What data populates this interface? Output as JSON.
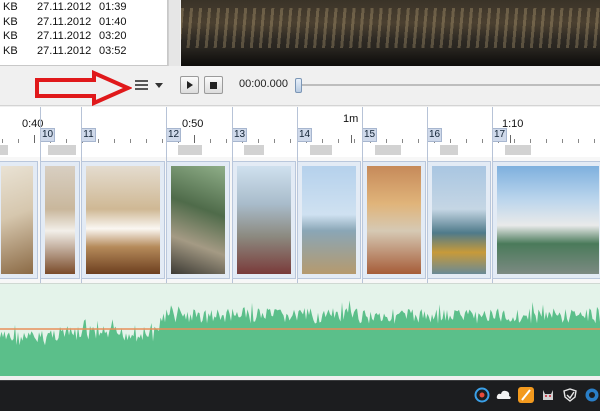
{
  "file_list": {
    "rows": [
      {
        "size": "KB",
        "date": "27.11.2012",
        "time": "01:39"
      },
      {
        "size": "KB",
        "date": "27.11.2012",
        "time": "01:40"
      },
      {
        "size": "KB",
        "date": "27.11.2012",
        "time": "03:20"
      },
      {
        "size": "KB",
        "date": "27.11.2012",
        "time": "03:52"
      }
    ]
  },
  "player": {
    "time": "00:00.000",
    "play_icon": "play-icon",
    "stop_icon": "stop-icon",
    "menu_icon": "hamburger-menu-icon"
  },
  "annotation": {
    "color": "#e0191b"
  },
  "timeline": {
    "ruler_labels": [
      "0:40",
      "0:50",
      "1m",
      "1:10"
    ],
    "clip_numbers": [
      "10",
      "11",
      "12",
      "13",
      "14",
      "15",
      "16",
      "17"
    ]
  },
  "colors": {
    "waveform": "#5bbf8a",
    "level_line": "#e8905a",
    "clip_border": "#b9c7dc",
    "clip_number_bg": "#cfd9ea"
  },
  "tray_icons": [
    "sync-icon",
    "cloud-icon",
    "orange-app-icon",
    "cat-icon",
    "antivirus-icon",
    "network-icon"
  ]
}
